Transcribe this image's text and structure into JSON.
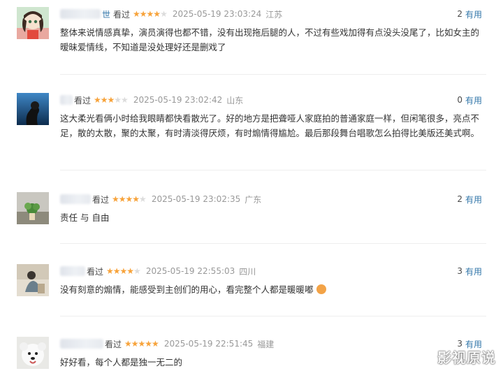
{
  "reviews": [
    {
      "name_tail": "世",
      "watched": "看过",
      "rating": 4,
      "time": "2025-05-19 23:03:24",
      "location": "江苏",
      "votes": "2",
      "useful": "有用",
      "content": "整体来说情感真挚，演员演得也都不错，没有出现拖后腿的人，不过有些戏加得有点没头没尾了，比如女主的暧昧爱情线，不知道是没处理好还是删戏了"
    },
    {
      "name_tail": "",
      "watched": "看过",
      "rating": 3,
      "time": "2025-05-19 23:02:42",
      "location": "山东",
      "votes": "0",
      "useful": "有用",
      "content": "这大柔光看俩小时给我眼睛都快看散光了。好的地方是把聋哑人家庭拍的普通家庭一样，但闲笔很多，亮点不足，散的太散，聚的太聚，有时清淡得厌烦，有时煽情得尴尬。最后那段舞台唱歌怎么拍得比美版还美式啊。"
    },
    {
      "name_tail": "",
      "watched": "看过",
      "rating": 4,
      "time": "2025-05-19 23:02:35",
      "location": "广东",
      "votes": "2",
      "useful": "有用",
      "content": "责任 与 自由"
    },
    {
      "name_tail": "",
      "watched": "看过",
      "rating": 4,
      "time": "2025-05-19 22:55:03",
      "location": "四川",
      "votes": "3",
      "useful": "有用",
      "content": "没有刻意的煽情，能感受到主创们的用心，看完整个人都是暖暖嘟"
    },
    {
      "name_tail": "",
      "watched": "看过",
      "rating": 5,
      "time": "2025-05-19 22:51:45",
      "location": "福建",
      "votes": "3",
      "useful": "有用",
      "content": "好好看，每个人都是独一无二的"
    }
  ],
  "watermark": "影视原说",
  "colors": {
    "star": "#f7a33b",
    "link": "#3377aa",
    "muted": "#999999"
  }
}
